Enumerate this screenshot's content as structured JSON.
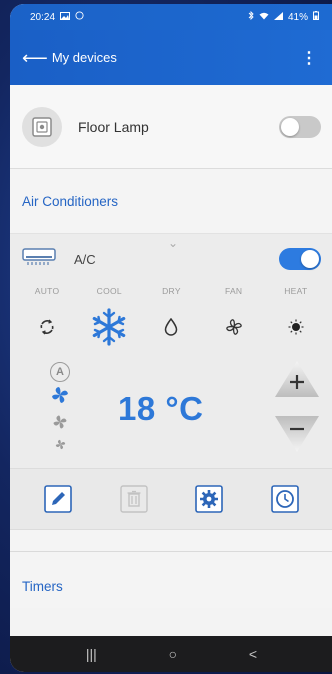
{
  "status_bar": {
    "time": "20:24",
    "battery": "41%"
  },
  "header": {
    "back_label": "My devices",
    "menu_glyph": "⋮"
  },
  "lamp": {
    "name": "Floor Lamp",
    "power_on": false
  },
  "ac_section": {
    "title": "Air Conditioners"
  },
  "ac": {
    "name": "A/C",
    "power_on": true,
    "chevron": "⌄",
    "modes": [
      {
        "label": "AUTO",
        "icon": "auto-mode-icon"
      },
      {
        "label": "COOL",
        "icon": "snowflake-icon",
        "selected": true
      },
      {
        "label": "DRY",
        "icon": "droplet-icon"
      },
      {
        "label": "FAN",
        "icon": "fan-icon"
      },
      {
        "label": "HEAT",
        "icon": "sun-icon"
      }
    ],
    "fan_auto_label": "A",
    "temperature": "18 °C"
  },
  "timers": {
    "title": "Timers"
  },
  "colors": {
    "accent": "#2d78d8",
    "header": "#1d65cc",
    "toggle_off": "#c9c9c9"
  },
  "nav": {
    "recents": "|||",
    "home": "○",
    "back": "<"
  }
}
